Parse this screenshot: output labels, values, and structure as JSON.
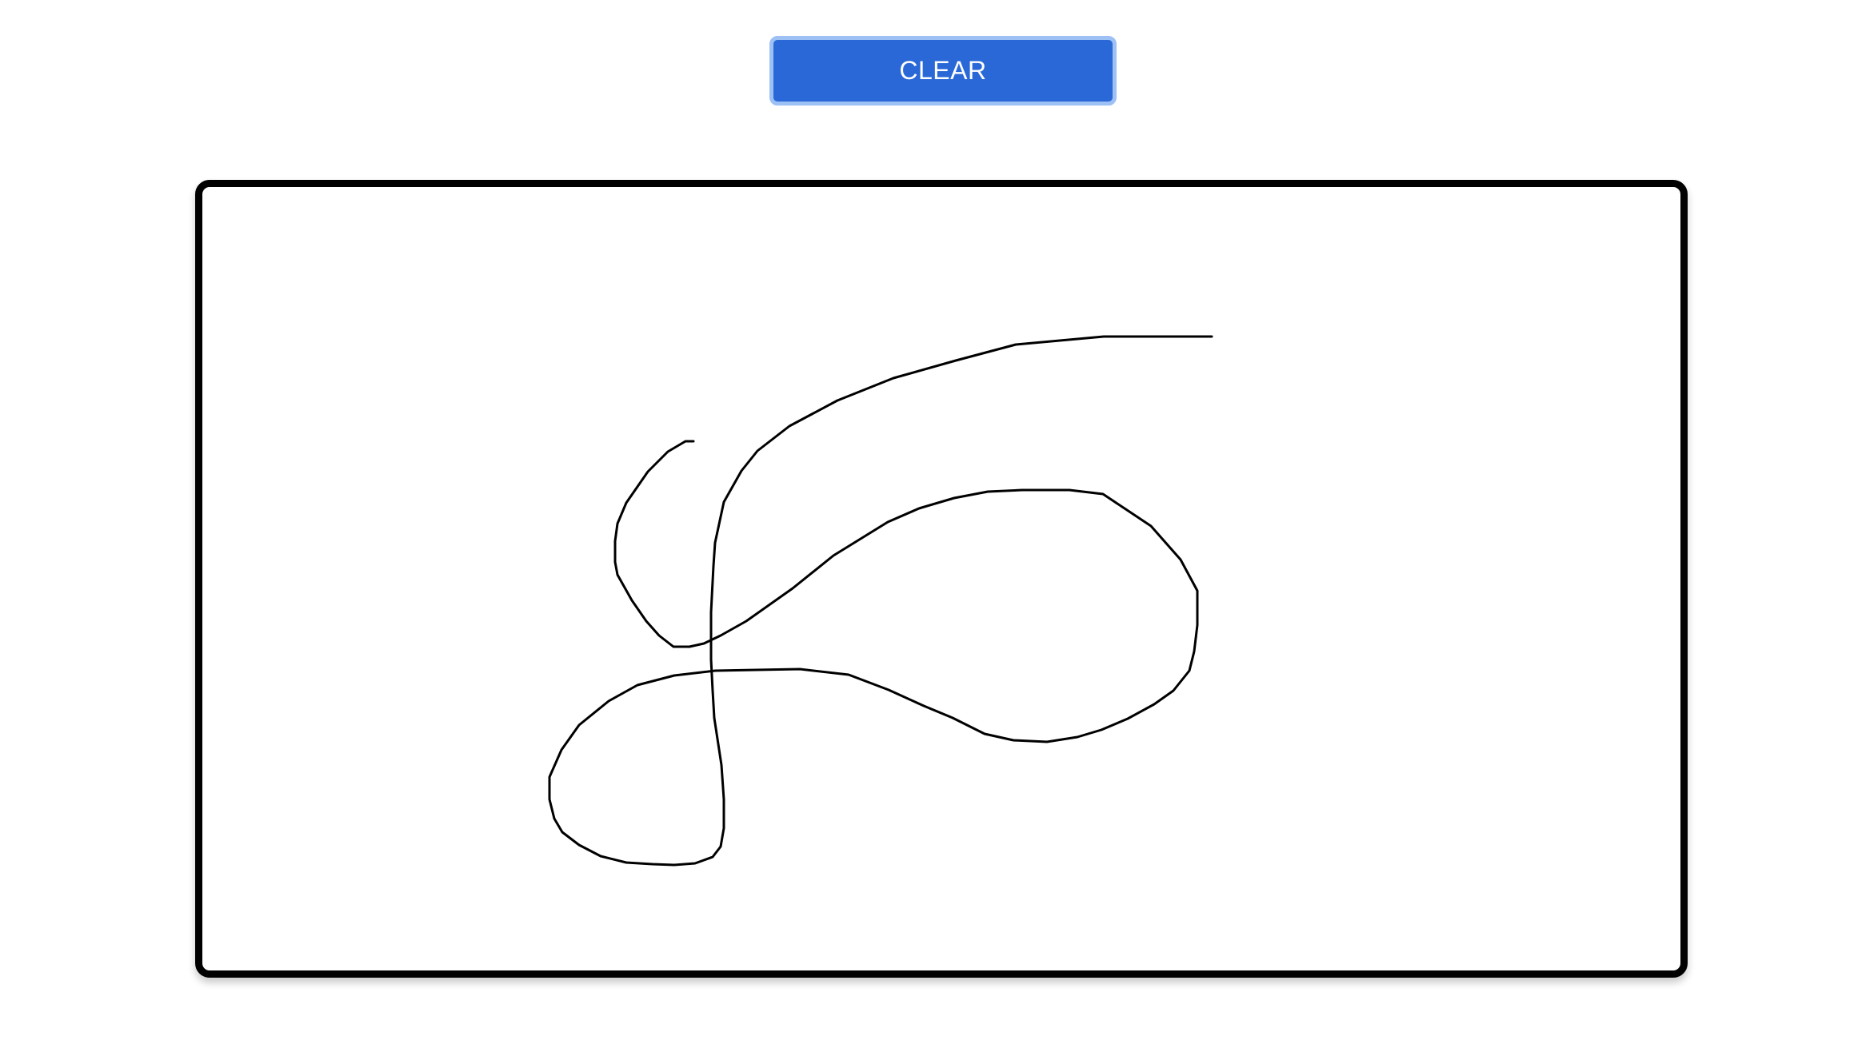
{
  "toolbar": {
    "clear_label": "CLEAR"
  },
  "colors": {
    "button_bg": "#2968d6",
    "button_border": "#9dc0f5",
    "canvas_border": "#000000",
    "stroke": "#000000"
  },
  "icons": []
}
